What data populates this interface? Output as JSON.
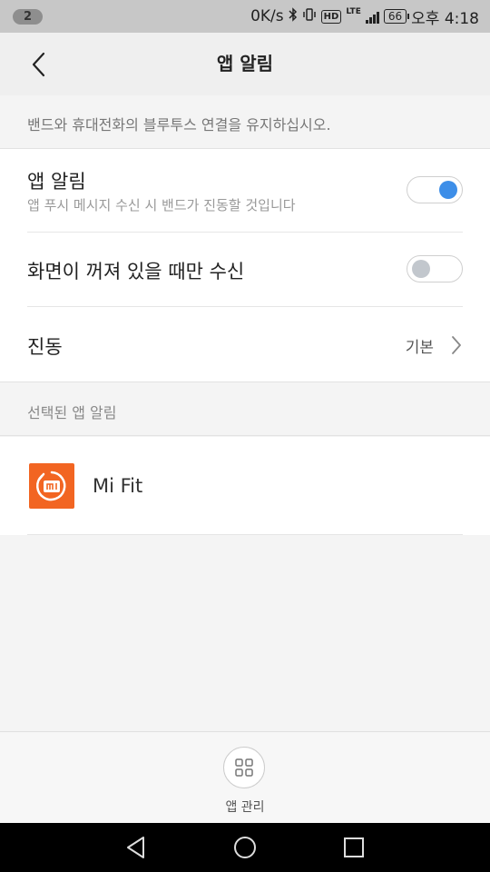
{
  "status_bar": {
    "notification_count": "2",
    "network_speed": "0K/s",
    "hd": "HD",
    "lte": "LTE",
    "battery": "66",
    "time": "오후 4:18"
  },
  "header": {
    "title": "앱 알림"
  },
  "notice": "밴드와 휴대전화의 블루투스 연결을 유지하십시오.",
  "settings": {
    "app_alerts": {
      "title": "앱 알림",
      "subtitle": "앱 푸시 메시지 수신 시 밴드가 진동할 것입니다",
      "enabled": true
    },
    "screen_off_only": {
      "title": "화면이 꺼져 있을 때만 수신",
      "enabled": false
    },
    "vibration": {
      "title": "진동",
      "value": "기본"
    }
  },
  "selected_section_label": "선택된 앱 알림",
  "apps": [
    {
      "name": "Mi Fit",
      "icon": "mi-fit-icon"
    }
  ],
  "bottom": {
    "manage_label": "앱 관리"
  },
  "colors": {
    "accent": "#3d8ee8",
    "app_icon_bg": "#f26522"
  }
}
